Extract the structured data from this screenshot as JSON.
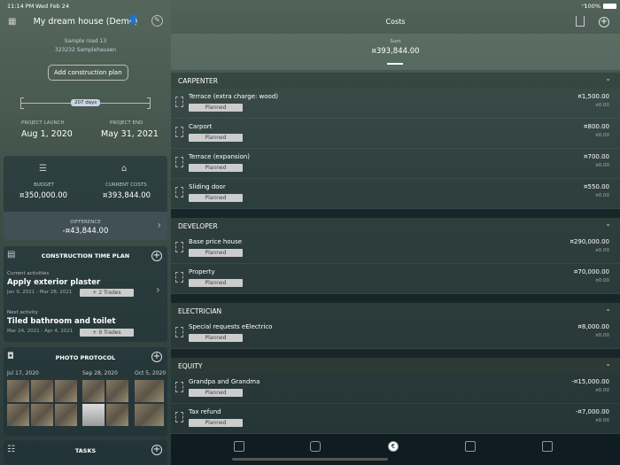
{
  "status": {
    "time": "11:14 PM",
    "date": "Wed Feb 24",
    "battery": "100%"
  },
  "project": {
    "title": "My dream house (Demo)",
    "address1": "Sample road 13",
    "address2": "323232 Samplehausen",
    "add_plan": "Add construction plan",
    "days": "207 days",
    "launch_label": "PROJECT LAUNCH",
    "launch": "Aug 1, 2020",
    "end_label": "PROJECT END",
    "end": "May 31, 2021"
  },
  "budget": {
    "budget_label": "BUDGET",
    "budget": "¤350,000.00",
    "costs_label": "CURRENT COSTS",
    "costs": "¤393,844.00",
    "diff_label": "DIFFERENCE",
    "diff": "-¤43,844.00"
  },
  "timeplan": {
    "title": "CONSTRUCTION TIME PLAN",
    "current_label": "Current activities",
    "current": "Apply exterior plaster",
    "current_dates": "Jan 9, 2021 - Mar 28, 2021",
    "current_trades": "+ 2 Trades",
    "next_label": "Next activity",
    "next": "Tiled bathroom and toilet",
    "next_dates": "Mar 24, 2021 - Apr 4, 2021",
    "next_trades": "+ 9 Trades"
  },
  "photos": {
    "title": "PHOTO PROTOCOL",
    "dates": [
      "Jul 17, 2020",
      "Sep 28, 2020",
      "Oct 5, 2020"
    ]
  },
  "tasks": {
    "title": "TASKS"
  },
  "costs": {
    "title": "Costs",
    "sum_label": "Sum",
    "sum": "¤393,844.00",
    "sections": [
      {
        "name": "CARPENTER",
        "items": [
          {
            "name": "Terrace (extra charge: wood)",
            "status": "Planned",
            "amount": "¤1,500.00",
            "paid": "¤0.00"
          },
          {
            "name": "Carport",
            "status": "Planned",
            "amount": "¤800.00",
            "paid": "¤0.00"
          },
          {
            "name": "Terrace (expansion)",
            "status": "Planned",
            "amount": "¤700.00",
            "paid": "¤0.00"
          },
          {
            "name": "Sliding door",
            "status": "Planned",
            "amount": "¤550.00",
            "paid": "¤0.00"
          }
        ]
      },
      {
        "name": "DEVELOPER",
        "items": [
          {
            "name": "Base price house",
            "status": "Planned",
            "amount": "¤290,000.00",
            "paid": "¤0.00"
          },
          {
            "name": "Property",
            "status": "Planned",
            "amount": "¤70,000.00",
            "paid": "¤0.00"
          }
        ]
      },
      {
        "name": "ELECTRICIAN",
        "items": [
          {
            "name": "Special requests eElectrico",
            "status": "Planned",
            "amount": "¤8,000.00",
            "paid": "¤0.00"
          }
        ]
      },
      {
        "name": "EQUITY",
        "items": [
          {
            "name": "Grandpa and Grandma",
            "status": "Planned",
            "amount": "-¤15,000.00",
            "paid": "¤0.00"
          },
          {
            "name": "Tax refund",
            "status": "Planned",
            "amount": "-¤7,000.00",
            "paid": "¤0.00"
          }
        ]
      }
    ]
  }
}
